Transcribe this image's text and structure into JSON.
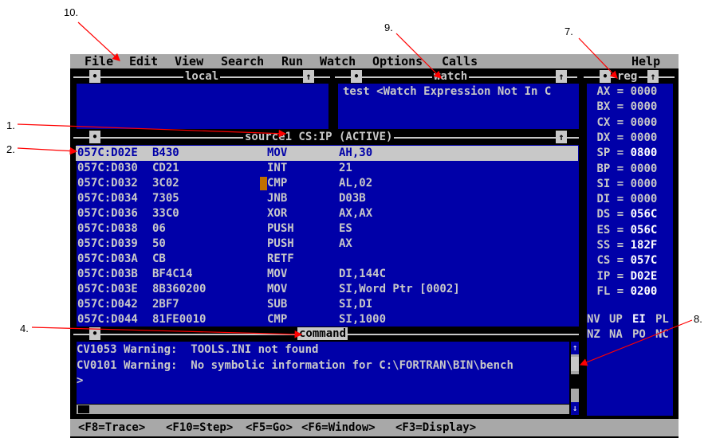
{
  "menu": [
    "File",
    "Edit",
    "View",
    "Search",
    "Run",
    "Watch",
    "Options",
    "Calls",
    "Help"
  ],
  "panes": {
    "local_title": "local",
    "watch_title": "watch",
    "reg_title": "reg",
    "source_title": "source1 CS:IP (ACTIVE)",
    "command_title": "command"
  },
  "watch": {
    "line": "test <Watch Expression Not In C"
  },
  "source": {
    "rows": [
      {
        "addr": "057C:D02E",
        "bytes": "B430",
        "mnemonic": "MOV",
        "operand": "AH,30"
      },
      {
        "addr": "057C:D030",
        "bytes": "CD21",
        "mnemonic": "INT",
        "operand": "21"
      },
      {
        "addr": "057C:D032",
        "bytes": "3C02",
        "mnemonic": "CMP",
        "operand": "AL,02"
      },
      {
        "addr": "057C:D034",
        "bytes": "7305",
        "mnemonic": "JNB",
        "operand": "D03B"
      },
      {
        "addr": "057C:D036",
        "bytes": "33C0",
        "mnemonic": "XOR",
        "operand": "AX,AX"
      },
      {
        "addr": "057C:D038",
        "bytes": "06",
        "mnemonic": "PUSH",
        "operand": "ES"
      },
      {
        "addr": "057C:D039",
        "bytes": "50",
        "mnemonic": "PUSH",
        "operand": "AX"
      },
      {
        "addr": "057C:D03A",
        "bytes": "CB",
        "mnemonic": "RETF",
        "operand": ""
      },
      {
        "addr": "057C:D03B",
        "bytes": "BF4C14",
        "mnemonic": "MOV",
        "operand": "DI,144C"
      },
      {
        "addr": "057C:D03E",
        "bytes": "8B360200",
        "mnemonic": "MOV",
        "operand": "SI,Word Ptr [0002]"
      },
      {
        "addr": "057C:D042",
        "bytes": "2BF7",
        "mnemonic": "SUB",
        "operand": "SI,DI"
      },
      {
        "addr": "057C:D044",
        "bytes": "81FE0010",
        "mnemonic": "CMP",
        "operand": "SI,1000"
      }
    ]
  },
  "registers": [
    {
      "name": "AX",
      "value": "0000",
      "changed": false
    },
    {
      "name": "BX",
      "value": "0000",
      "changed": false
    },
    {
      "name": "CX",
      "value": "0000",
      "changed": false
    },
    {
      "name": "DX",
      "value": "0000",
      "changed": false
    },
    {
      "name": "SP",
      "value": "0800",
      "changed": true
    },
    {
      "name": "BP",
      "value": "0000",
      "changed": false
    },
    {
      "name": "SI",
      "value": "0000",
      "changed": false
    },
    {
      "name": "DI",
      "value": "0000",
      "changed": false
    },
    {
      "name": "DS",
      "value": "056C",
      "changed": true
    },
    {
      "name": "ES",
      "value": "056C",
      "changed": true
    },
    {
      "name": "SS",
      "value": "182F",
      "changed": true
    },
    {
      "name": "CS",
      "value": "057C",
      "changed": true
    },
    {
      "name": "IP",
      "value": "D02E",
      "changed": true
    },
    {
      "name": "FL",
      "value": "0200",
      "changed": true
    }
  ],
  "flags": {
    "row1": [
      "NV",
      "UP",
      "EI",
      "PL"
    ],
    "row2": [
      "NZ",
      "NA",
      "PO",
      "NC"
    ],
    "bright": [
      "EI"
    ]
  },
  "command": {
    "lines": [
      "CV1053 Warning:  TOOLS.INI not found",
      "CV0101 Warning:  No symbolic information for C:\\FORTRAN\\BIN\\bench",
      ">"
    ]
  },
  "status": [
    "<F8=Trace>",
    "<F10=Step>",
    "<F5=Go>",
    "<F6=Window>",
    "<F3=Display>"
  ],
  "callouts": [
    "1.",
    "2.",
    "4.",
    "7.",
    "8.",
    "9.",
    "10."
  ],
  "colors": {
    "pane_blue": "#0000a8",
    "menu_grey": "#a8a8a8",
    "text_grey": "#c8c8c8",
    "arrow_red": "#ff0000"
  }
}
